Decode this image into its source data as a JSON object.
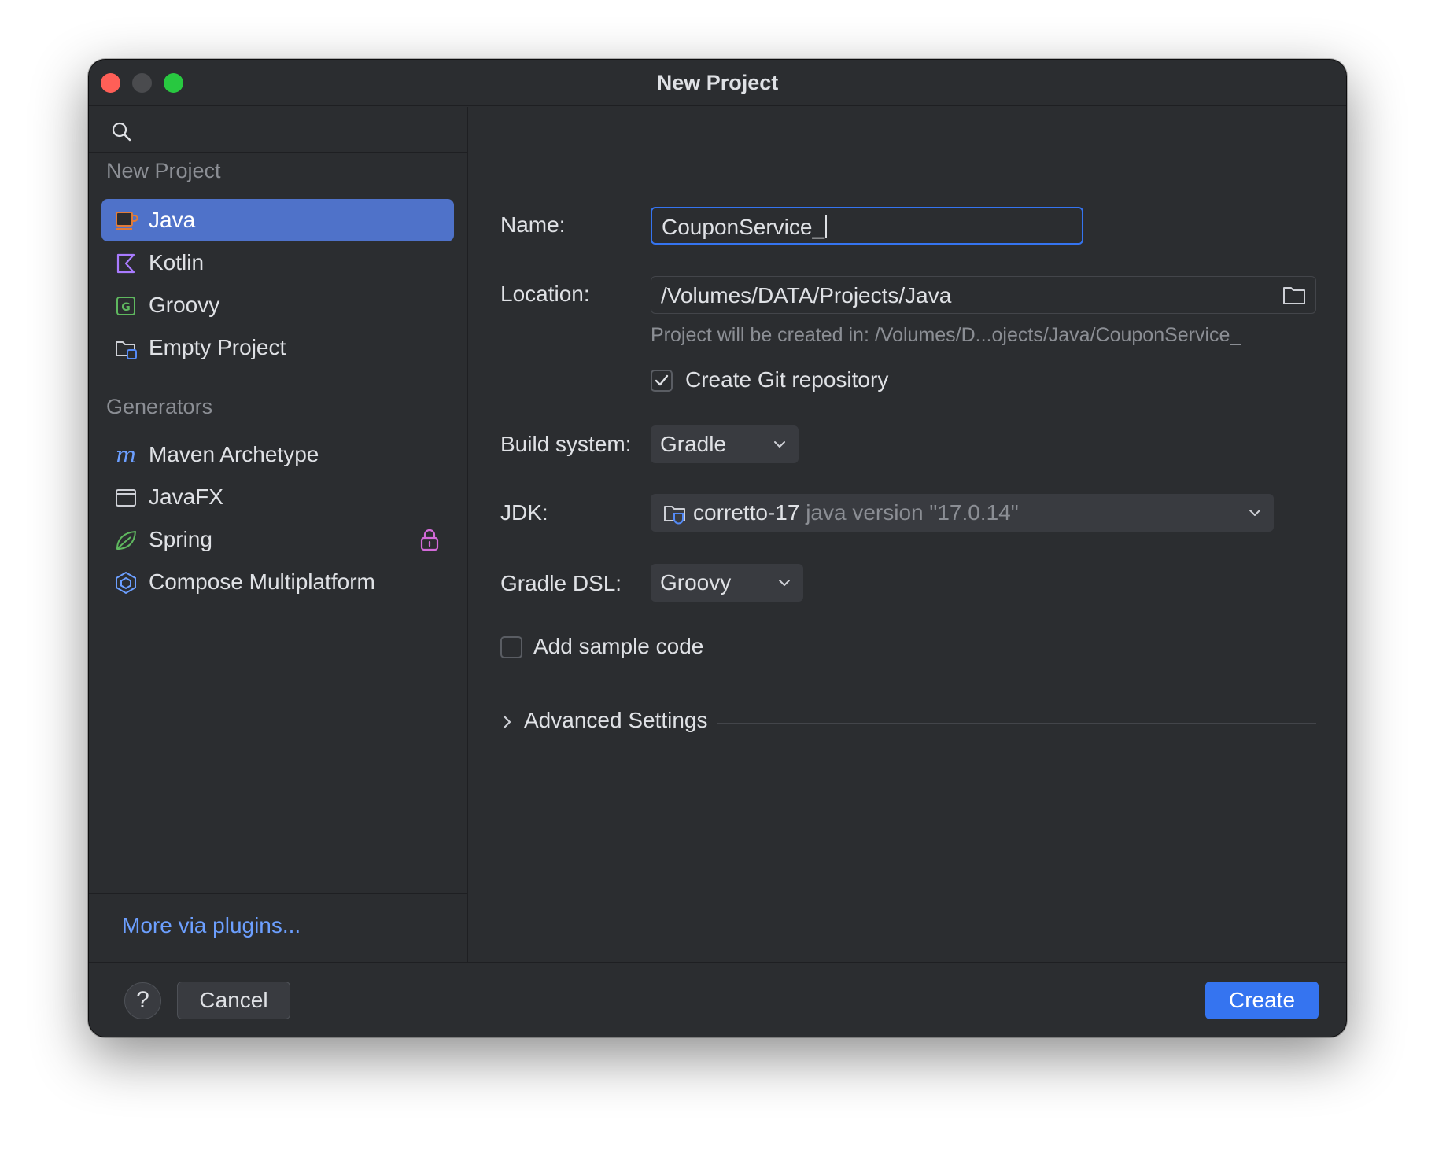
{
  "window": {
    "title": "New Project"
  },
  "sidebar": {
    "search": {
      "placeholder": ""
    },
    "new_project_heading": "New Project",
    "items": [
      {
        "label": "Java",
        "icon": "java-icon",
        "selected": true
      },
      {
        "label": "Kotlin",
        "icon": "kotlin-icon"
      },
      {
        "label": "Groovy",
        "icon": "groovy-icon"
      },
      {
        "label": "Empty Project",
        "icon": "empty-project-icon"
      }
    ],
    "generators_heading": "Generators",
    "generators": [
      {
        "label": "Maven Archetype",
        "icon": "maven-icon"
      },
      {
        "label": "JavaFX",
        "icon": "javafx-icon"
      },
      {
        "label": "Spring",
        "icon": "spring-icon",
        "locked": true
      },
      {
        "label": "Compose Multiplatform",
        "icon": "compose-icon"
      }
    ],
    "more_link": "More via plugins..."
  },
  "form": {
    "name_label": "Name:",
    "name_value": "CouponService_",
    "location_label": "Location:",
    "location_value": "/Volumes/DATA/Projects/Java",
    "location_hint": "Project will be created in: /Volumes/D...ojects/Java/CouponService_",
    "git_label": "Create Git repository",
    "git_checked": true,
    "build_label": "Build system:",
    "build_value": "Gradle",
    "jdk_label": "JDK:",
    "jdk_value": "corretto-17",
    "jdk_version": "java version \"17.0.14\"",
    "dsl_label": "Gradle DSL:",
    "dsl_value": "Groovy",
    "sample_label": "Add sample code",
    "sample_checked": false,
    "advanced_label": "Advanced Settings"
  },
  "buttons": {
    "help": "?",
    "cancel": "Cancel",
    "create": "Create"
  },
  "colors": {
    "accent": "#3574f0",
    "selection": "#4f72c9",
    "link": "#6c9fff",
    "background": "#2b2d30"
  }
}
